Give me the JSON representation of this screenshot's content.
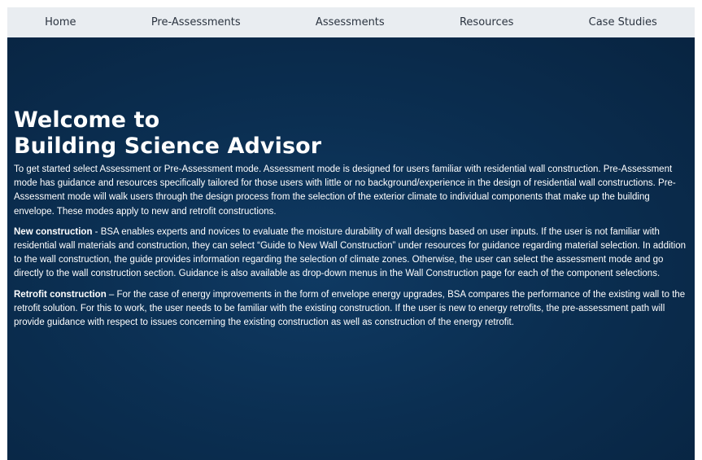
{
  "nav": {
    "items": [
      {
        "label": "Home"
      },
      {
        "label": "Pre-Assessments"
      },
      {
        "label": "Assessments"
      },
      {
        "label": "Resources"
      },
      {
        "label": "Case Studies"
      }
    ]
  },
  "hero": {
    "title_line1": "Welcome to",
    "title_line2": "Building Science Advisor",
    "intro": "To get started select Assessment or Pre-Assessment mode. Assessment mode is designed for users familiar with residential wall construction. Pre-Assessment mode has guidance and resources specifically tailored for those users with little or no background/experience in the design of residential wall constructions. Pre-Assessment mode will walk users through the design process from the selection of the exterior climate to individual components that make up the building envelope. These modes apply to new and retrofit constructions.",
    "new_construction_heading": "New construction",
    "new_construction_text": " - BSA enables experts and novices to evaluate the moisture durability of wall designs based on user inputs. If the user is not familiar with residential wall materials and construction, they can select “Guide to New Wall Construction” under resources for guidance regarding material selection. In addition to the wall construction, the guide provides information regarding the selection of climate zones. Otherwise, the user can select the assessment mode and go directly to the wall construction section. Guidance is also available as drop-down menus in the Wall Construction page for each of the component selections.",
    "retrofit_heading": "Retrofit construction",
    "retrofit_text": " – For the case of energy improvements in the form of envelope energy upgrades, BSA compares the performance of the existing wall to the retrofit solution. For this to work, the user needs to be familiar with the existing construction. If the user is new to energy retrofits, the pre-assessment path will provide guidance with respect to issues concerning the existing construction as well as construction of the energy retrofit."
  },
  "colors": {
    "nav_background": "#e9edf1",
    "hero_background": "#0b2f52",
    "hero_text": "#ffffff"
  }
}
